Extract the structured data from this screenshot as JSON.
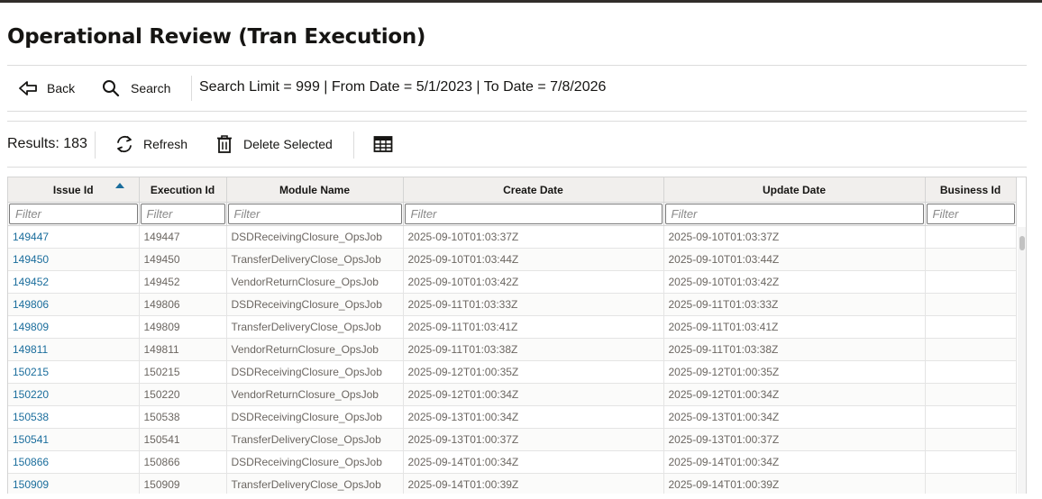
{
  "page": {
    "title": "Operational Review (Tran Execution)"
  },
  "toolbar": {
    "back_label": "Back",
    "search_label": "Search",
    "criteria": "Search Limit = 999 | From Date = 5/1/2023 | To Date = 7/8/2026"
  },
  "results_bar": {
    "count_text": "Results: 183",
    "refresh_label": "Refresh",
    "delete_label": "Delete Selected"
  },
  "table": {
    "columns": [
      "Issue Id",
      "Execution Id",
      "Module Name",
      "Create Date",
      "Update Date",
      "Business Id"
    ],
    "filter_placeholder": "Filter",
    "sorted_column": "Issue Id",
    "rows": [
      [
        "149447",
        "149447",
        "DSDReceivingClosure_OpsJob",
        "2025-09-10T01:03:37Z",
        "2025-09-10T01:03:37Z",
        ""
      ],
      [
        "149450",
        "149450",
        "TransferDeliveryClose_OpsJob",
        "2025-09-10T01:03:44Z",
        "2025-09-10T01:03:44Z",
        ""
      ],
      [
        "149452",
        "149452",
        "VendorReturnClosure_OpsJob",
        "2025-09-10T01:03:42Z",
        "2025-09-10T01:03:42Z",
        ""
      ],
      [
        "149806",
        "149806",
        "DSDReceivingClosure_OpsJob",
        "2025-09-11T01:03:33Z",
        "2025-09-11T01:03:33Z",
        ""
      ],
      [
        "149809",
        "149809",
        "TransferDeliveryClose_OpsJob",
        "2025-09-11T01:03:41Z",
        "2025-09-11T01:03:41Z",
        ""
      ],
      [
        "149811",
        "149811",
        "VendorReturnClosure_OpsJob",
        "2025-09-11T01:03:38Z",
        "2025-09-11T01:03:38Z",
        ""
      ],
      [
        "150215",
        "150215",
        "DSDReceivingClosure_OpsJob",
        "2025-09-12T01:00:35Z",
        "2025-09-12T01:00:35Z",
        ""
      ],
      [
        "150220",
        "150220",
        "VendorReturnClosure_OpsJob",
        "2025-09-12T01:00:34Z",
        "2025-09-12T01:00:34Z",
        ""
      ],
      [
        "150538",
        "150538",
        "DSDReceivingClosure_OpsJob",
        "2025-09-13T01:00:34Z",
        "2025-09-13T01:00:34Z",
        ""
      ],
      [
        "150541",
        "150541",
        "TransferDeliveryClose_OpsJob",
        "2025-09-13T01:00:37Z",
        "2025-09-13T01:00:37Z",
        ""
      ],
      [
        "150866",
        "150866",
        "DSDReceivingClosure_OpsJob",
        "2025-09-14T01:00:34Z",
        "2025-09-14T01:00:34Z",
        ""
      ],
      [
        "150909",
        "150909",
        "TransferDeliveryClose_OpsJob",
        "2025-09-14T01:00:39Z",
        "2025-09-14T01:00:39Z",
        ""
      ]
    ]
  }
}
